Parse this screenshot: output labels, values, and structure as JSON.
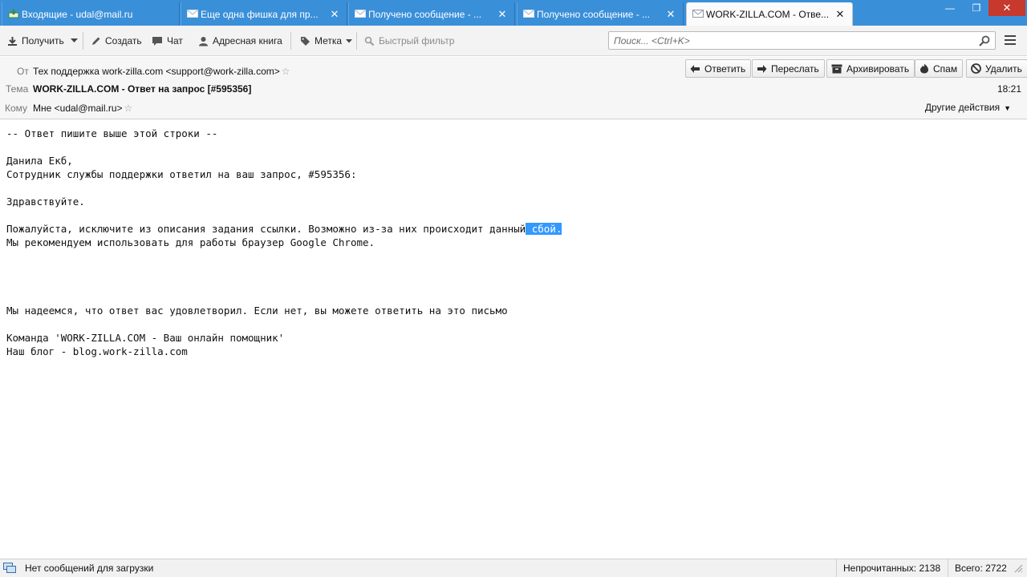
{
  "tabs": [
    {
      "label": "Входящие - udal@mail.ru",
      "icon": "inbox-icon",
      "active": false
    },
    {
      "label": "Еще одна фишка для пр...",
      "icon": "envelope-icon",
      "active": false
    },
    {
      "label": "Получено сообщение - ...",
      "icon": "envelope-icon",
      "active": false
    },
    {
      "label": "Получено сообщение - ...",
      "icon": "envelope-icon",
      "active": false
    },
    {
      "label": "WORK-ZILLA.COM - Отве...",
      "icon": "envelope-icon",
      "active": true
    }
  ],
  "window_controls": {
    "minimize": "—",
    "maximize": "❐",
    "close": "✕"
  },
  "toolbar": {
    "get_label": "Получить",
    "write_label": "Создать",
    "chat_label": "Чат",
    "addressbook_label": "Адресная книга",
    "tag_label": "Метка",
    "quickfilter_label": "Быстрый фильтр"
  },
  "search": {
    "placeholder": "Поиск... <Ctrl+K>",
    "value": ""
  },
  "header": {
    "from_label": "От",
    "from_value": "Тех поддержка work-zilla.com <support@work-zilla.com>",
    "subject_label": "Тема",
    "subject_value": "WORK-ZILLA.COM - Ответ на запрос [#595356]",
    "to_label": "Кому",
    "to_value": "Мне <udal@mail.ru>",
    "time": "18:21",
    "other_actions": "Другие действия"
  },
  "actions": {
    "reply": "Ответить",
    "forward": "Переслать",
    "archive": "Архивировать",
    "spam": "Спам",
    "delete": "Удалить"
  },
  "message": {
    "line1": "-- Ответ пишите выше этой строки --",
    "line2": "Данила Екб,",
    "line3": "Сотрудник службы поддержки ответил на ваш запрос, #595356:",
    "line4": "Здравствуйте.",
    "line5_before": "Пожалуйста, исключите из описания задания ссылки. Возможно из-за них происходит данный",
    "line5_selected": " сбой.",
    "line6": "Мы рекомендуем использовать для работы браузер Google Chrome.",
    "line7": "Мы надеемся, что ответ вас удовлетворил. Если нет, вы можете ответить на это письмо",
    "line8": "Команда 'WORK-ZILLA.COM - Ваш онлайн помощник'",
    "line9": "Наш блог - blog.work-zilla.com"
  },
  "status": {
    "message": "Нет сообщений для загрузки",
    "unread": "Непрочитанных: 2138",
    "total": "Всего: 2722"
  },
  "colors": {
    "tabbar": "#3a8fd9",
    "selection": "#3399ff"
  }
}
